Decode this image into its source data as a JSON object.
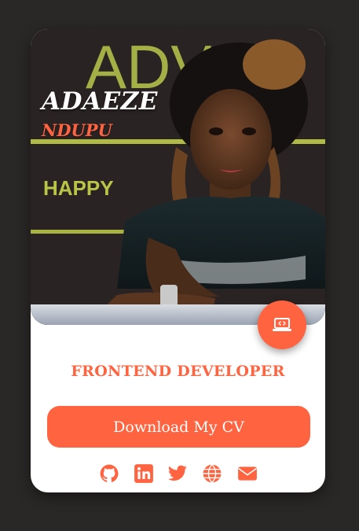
{
  "profile": {
    "first_name": "ADAEZE",
    "last_name": "NDUPU",
    "role": "FRONTEND DEVELOPER"
  },
  "backdrop": {
    "banner_letters": "ADV",
    "banner_word": "HAPPY"
  },
  "actions": {
    "download_label": "Download My CV"
  },
  "socials": [
    {
      "icon": "github-icon"
    },
    {
      "icon": "linkedin-icon"
    },
    {
      "icon": "twitter-icon"
    },
    {
      "icon": "globe-icon"
    },
    {
      "icon": "envelope-icon"
    }
  ],
  "colors": {
    "accent": "#ff6340",
    "page_background": "#2a2827",
    "card_background": "#ffffff"
  }
}
